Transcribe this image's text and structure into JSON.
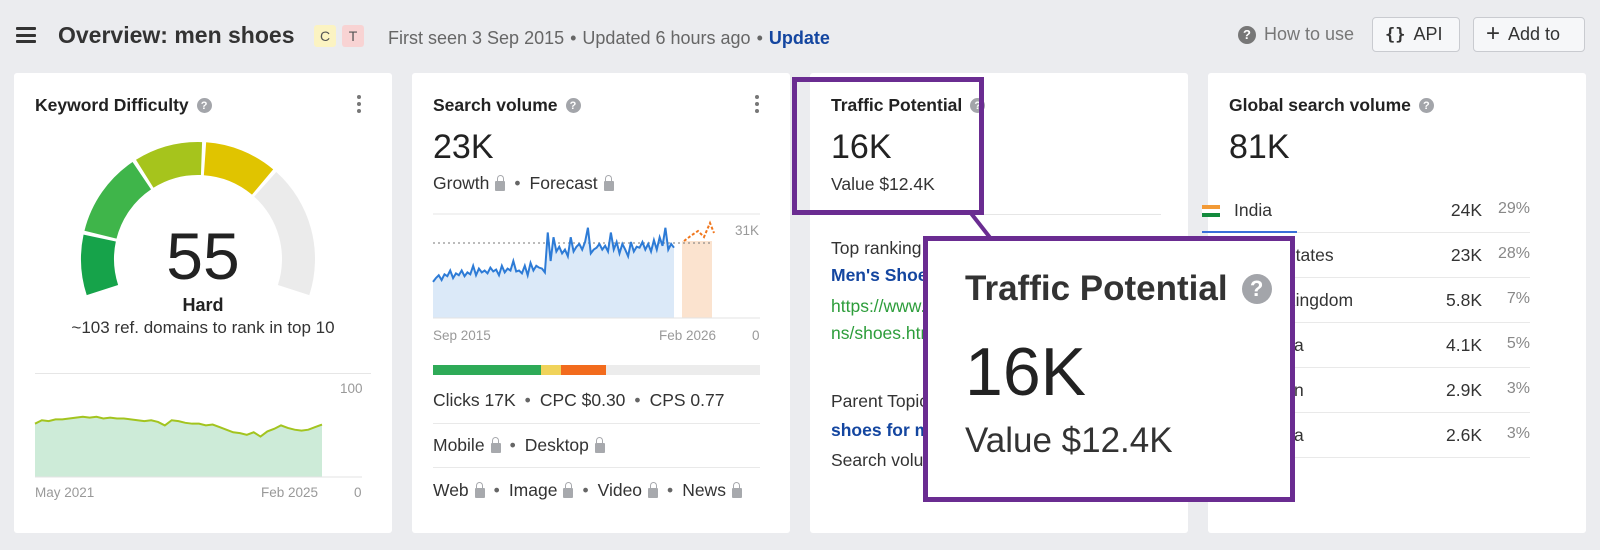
{
  "header": {
    "title": "Overview: men shoes",
    "intent_badges": [
      "C",
      "T"
    ],
    "first_seen": "First seen 3 Sep 2015",
    "updated": "Updated 6 hours ago",
    "update_link": "Update",
    "how_to_use": "How to use",
    "api_label": "API",
    "add_to_label": "Add to"
  },
  "keyword_difficulty": {
    "title": "Keyword Difficulty",
    "value": "55",
    "value_numeric": 55,
    "label": "Hard",
    "subtext": "~103 ref. domains to rank in top 10",
    "history_axis": {
      "start": "May 2021",
      "end": "Feb 2025",
      "ymax": "100",
      "ymin": "0"
    },
    "history": [
      62,
      66,
      65,
      67,
      67,
      68,
      69,
      70,
      69,
      70,
      68,
      69,
      68,
      68,
      67,
      66,
      65,
      66,
      64,
      60,
      66,
      65,
      63,
      62,
      62,
      60,
      61,
      58,
      55,
      52,
      51,
      49,
      52,
      47,
      53,
      56,
      60,
      57,
      55,
      54,
      55,
      58,
      61
    ],
    "colors": {
      "green_dark": "#16a34a",
      "green": "#3fb54a",
      "yellow_green": "#a6c41c",
      "yellow": "#e0c400",
      "grey": "#ebebeb"
    }
  },
  "search_volume": {
    "title": "Search volume",
    "value": "23K",
    "growth": "Growth",
    "forecast": "Forecast",
    "chart_axis": {
      "start": "Sep 2015",
      "end": "Feb 2026",
      "ymax": "31K",
      "ymin": "0"
    },
    "clicks": "Clicks 17K",
    "cpc": "CPC $0.30",
    "cps": "CPS 0.77",
    "devices": [
      "Mobile",
      "Desktop"
    ],
    "serp_types": [
      "Web",
      "Image",
      "Video",
      "News"
    ],
    "click_bar": {
      "organic_pct": 33,
      "paid_pct": 6,
      "other_pct": 14,
      "colors": [
        "#2eaa57",
        "#f0d35a",
        "#f26b1d"
      ]
    }
  },
  "traffic_potential": {
    "title": "Traffic Potential",
    "value": "16K",
    "value_label": "Value $12.4K",
    "top_ranking_label": "Top ranking re",
    "top_ranking_title": "Men's Shoes",
    "top_ranking_url_1": "https://www.fo",
    "top_ranking_url_2": "ns/shoes.htm",
    "parent_topic_label": "Parent Topic",
    "parent_topic_link": "shoes for me",
    "parent_search_volume": "Search volum"
  },
  "global_search_volume": {
    "title": "Global search volume",
    "value": "81K",
    "countries": [
      {
        "name": "India",
        "volume": "24K",
        "pct": "29%"
      },
      {
        "name": "States",
        "volume": "23K",
        "pct": "28%"
      },
      {
        "name": "Kingdom",
        "volume": "5.8K",
        "pct": "7%"
      },
      {
        "name": "a",
        "volume": "4.1K",
        "pct": "5%"
      },
      {
        "name": "n",
        "volume": "2.9K",
        "pct": "3%"
      },
      {
        "name": "a",
        "volume": "2.6K",
        "pct": "3%"
      }
    ]
  },
  "zoom": {
    "title": "Traffic Potential",
    "value": "16K",
    "value_label": "Value $12.4K",
    "highlight_color": "#6a2c91"
  }
}
